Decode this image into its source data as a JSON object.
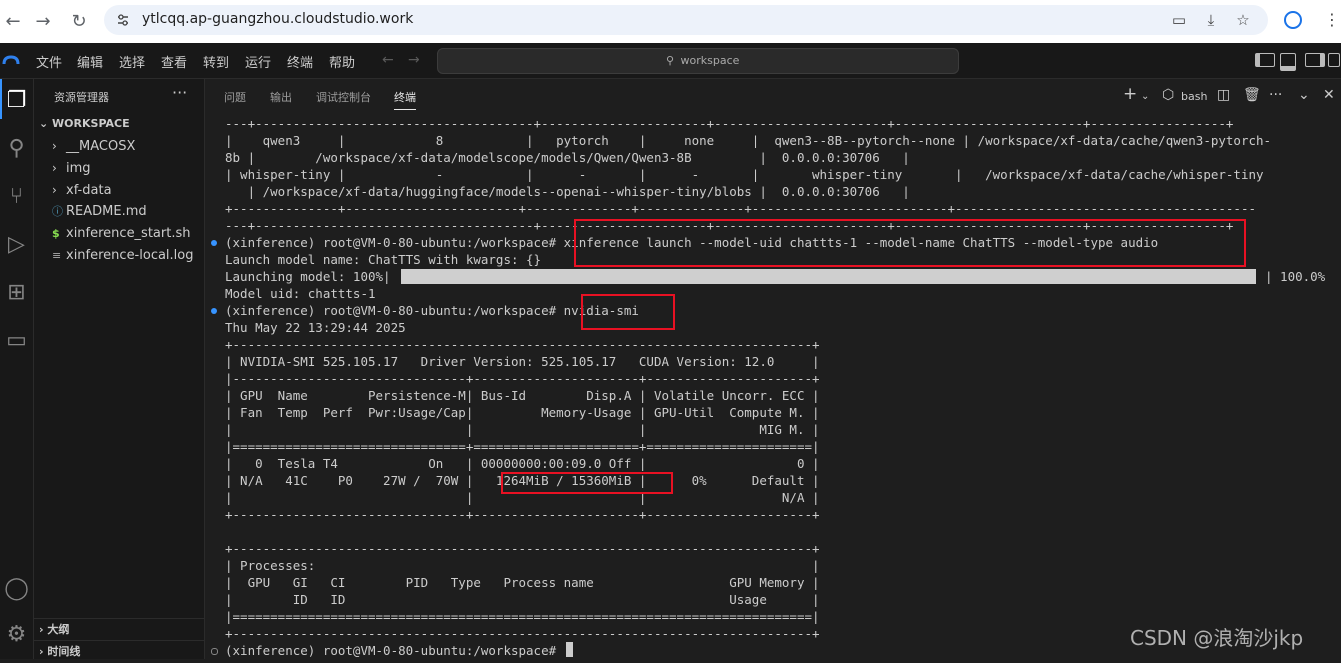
{
  "browser": {
    "url": "ytlcqq.ap-guangzhou.cloudstudio.work",
    "icons": [
      "back-icon",
      "forward-icon",
      "reload-icon",
      "site-info-icon",
      "reading-list-icon",
      "install-icon",
      "star-icon",
      "profile-icon",
      "more-icon"
    ]
  },
  "ide": {
    "menu": [
      "文件",
      "编辑",
      "选择",
      "查看",
      "转到",
      "运行",
      "终端",
      "帮助"
    ],
    "search_placeholder": "workspace"
  },
  "sidebar": {
    "title": "资源管理器",
    "more": "···",
    "workspace": "WORKSPACE",
    "items": [
      {
        "label": "__MACOSX",
        "kind": "folder"
      },
      {
        "label": "img",
        "kind": "folder"
      },
      {
        "label": "xf-data",
        "kind": "folder"
      },
      {
        "label": "README.md",
        "kind": "file"
      },
      {
        "label": "xinference_start.sh",
        "kind": "file"
      },
      {
        "label": "xinference-local.log",
        "kind": "file"
      }
    ],
    "outline": "大纲",
    "timeline": "时间线"
  },
  "panel": {
    "tabs": [
      "问题",
      "输出",
      "调试控制台",
      "终端"
    ],
    "active_tab": "终端",
    "shell": "bash"
  },
  "terminal": {
    "lines": [
      "---+-------------------------------------+----------------------+-----------------------+-------------------------+------------------+",
      "|    qwen3     |            8           |   pytorch    |     none     |  qwen3--8B--pytorch--none | /workspace/xf-data/cache/qwen3-pytorch-",
      "8b |        /workspace/xf-data/modelscope/models/Qwen/Qwen3-8B         |  0.0.0.0:30706   |",
      "| whisper-tiny |            -           |      -       |      -       |       whisper-tiny       |   /workspace/xf-data/cache/whisper-tiny",
      "   | /workspace/xf-data/huggingface/models--openai--whisper-tiny/blobs |  0.0.0.0:30706   |",
      "+--------------+-----------------------+--------------+--------------+--------------------------+----------------------------------------",
      "---+-------------------------------------+----------------------+-----------------------+-------------------------+------------------+",
      "(xinference) root@VM-0-80-ubuntu:/workspace# xinference launch --model-uid chattts-1 --model-name ChatTTS --model-type audio",
      "Launch model name: ChatTTS with kwargs: {}",
      "Launching model: 100%|",
      "Model uid: chattts-1",
      "(xinference) root@VM-0-80-ubuntu:/workspace# nvidia-smi",
      "Thu May 22 13:29:44 2025",
      "+-----------------------------------------------------------------------------+",
      "| NVIDIA-SMI 525.105.17   Driver Version: 525.105.17   CUDA Version: 12.0     |",
      "|-------------------------------+----------------------+----------------------+",
      "| GPU  Name        Persistence-M| Bus-Id        Disp.A | Volatile Uncorr. ECC |",
      "| Fan  Temp  Perf  Pwr:Usage/Cap|         Memory-Usage | GPU-Util  Compute M. |",
      "|                               |                      |               MIG M. |",
      "|===============================+======================+======================|",
      "|   0  Tesla T4            On   | 00000000:00:09.0 Off |                    0 |",
      "| N/A   41C    P0    27W /  70W |   1264MiB / 15360MiB |      0%      Default |",
      "|                               |                      |                  N/A |",
      "+-------------------------------+----------------------+----------------------+",
      "",
      "+-----------------------------------------------------------------------------+",
      "| Processes:                                                                  |",
      "|  GPU   GI   CI        PID   Type   Process name                  GPU Memory |",
      "|        ID   ID                                                   Usage      |",
      "|=============================================================================|",
      "+-----------------------------------------------------------------------------+",
      "(xinference) root@VM-0-80-ubuntu:/workspace# "
    ],
    "progress_suffix": "| 100.0%",
    "progress_fraction": 1.0
  },
  "watermark": "CSDN @浪淘沙jkp",
  "colors": {
    "highlight_box": "#e81123",
    "prompt_dot": "#3794ff",
    "background": "#1e1e1e"
  }
}
